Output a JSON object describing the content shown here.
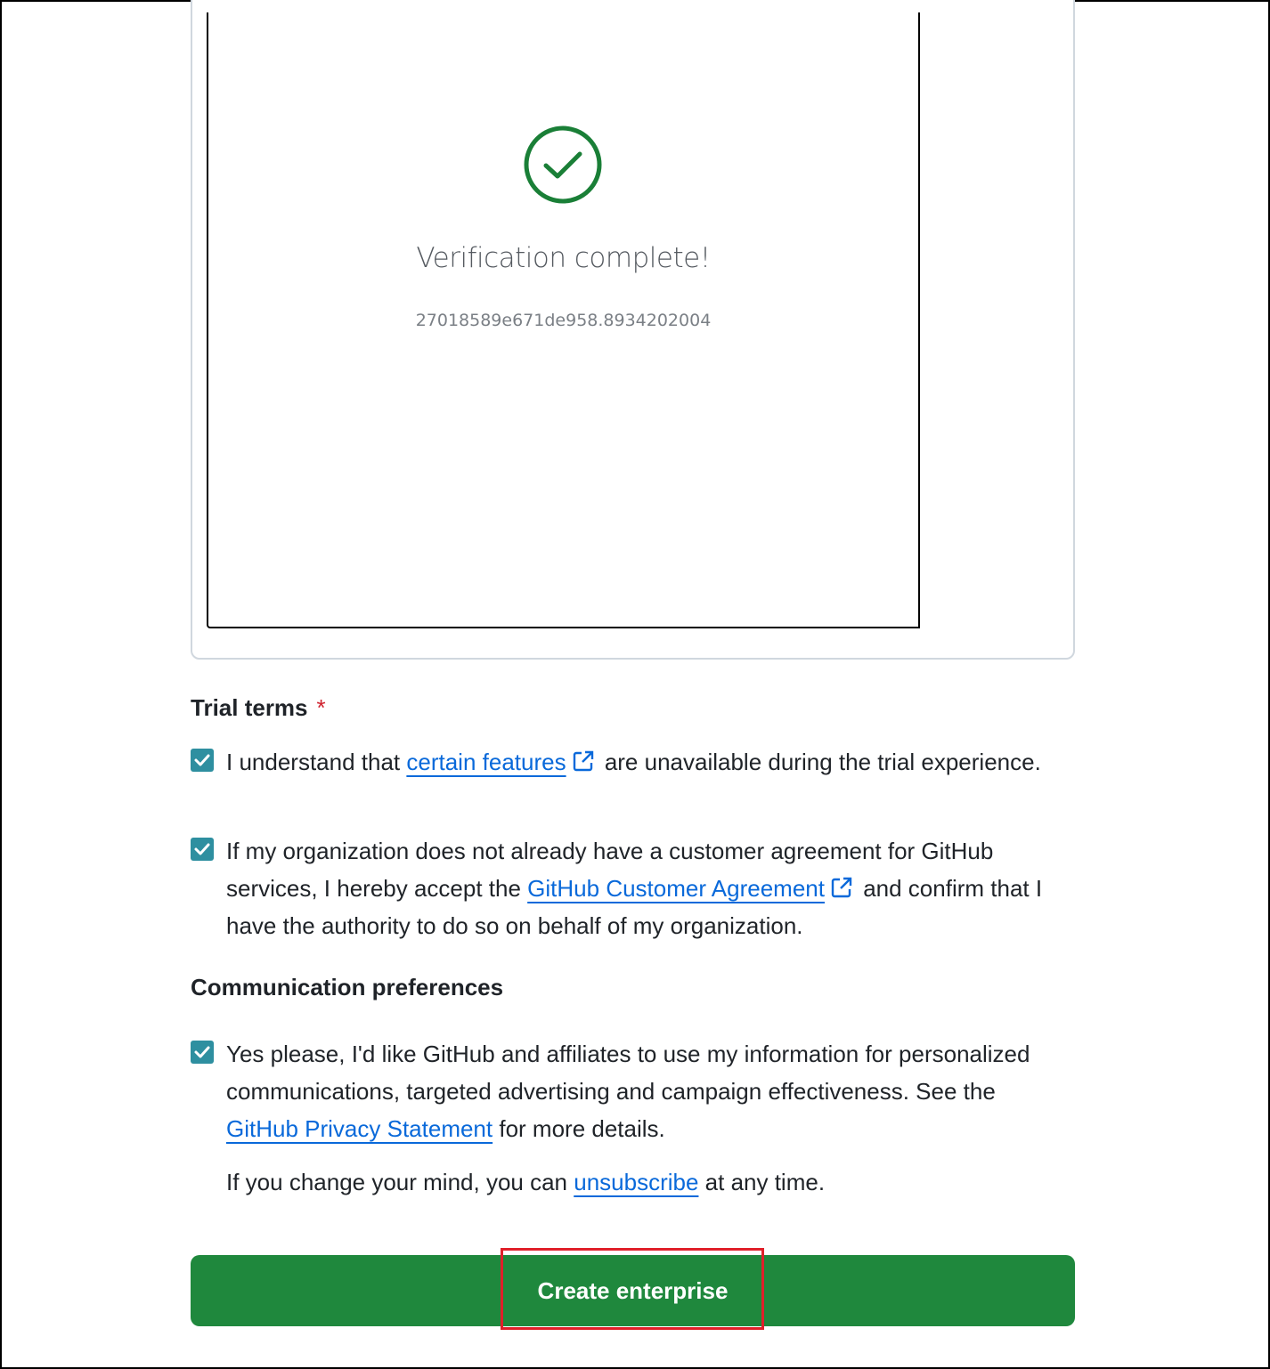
{
  "captcha": {
    "title": "Verification complete!",
    "token": "27018589e671de958.8934202004",
    "icon": "check-circle-icon",
    "icon_color": "#1a7f37"
  },
  "trial_terms": {
    "heading": "Trial terms",
    "required_marker": "*",
    "item1": {
      "checked": true,
      "text_before": "I understand that ",
      "link": "certain features",
      "text_after": " are unavailable during the trial experience."
    },
    "item2": {
      "checked": true,
      "text_before": "If my organization does not already have a customer agreement for GitHub services, I hereby accept the ",
      "link": "GitHub Customer Agreement",
      "text_after": " and confirm that I have the authority to do so on behalf of my organization."
    }
  },
  "communication": {
    "heading": "Communication preferences",
    "item1": {
      "checked": true,
      "text_before": "Yes please, I'd like GitHub and affiliates to use my information for personalized communications, targeted advertising and campaign effectiveness. See the ",
      "link": "GitHub Privacy Statement",
      "text_after": " for more details."
    },
    "unsubscribe": {
      "text_before": "If you change your mind, you can ",
      "link": "unsubscribe",
      "text_after": " at any time."
    }
  },
  "submit": {
    "label": "Create enterprise",
    "color": "#1f883d"
  },
  "colors": {
    "link": "#0969da",
    "checkbox": "#2e8fa0",
    "highlight": "#e0202a"
  }
}
